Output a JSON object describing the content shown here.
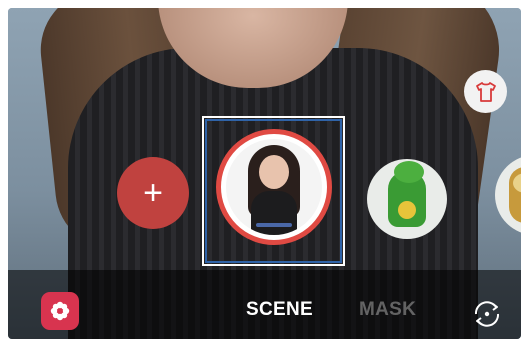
{
  "modes": {
    "scene_label": "SCENE",
    "mask_label": "MASK",
    "active": "SCENE"
  },
  "tiles": {
    "add_label": "+",
    "items": [
      "my-emoji",
      "dinosaur-sticker",
      "sloth-sticker"
    ],
    "selected": "my-emoji"
  },
  "icons": {
    "gallery": "flower-icon",
    "outfit": "shirt-icon",
    "switch_camera": "camera-switch-icon"
  },
  "colors": {
    "accent_red": "#e04a43",
    "add_button": "#c0423f",
    "gallery_button": "#d8344f",
    "focus_outline": "#2f63a8"
  }
}
